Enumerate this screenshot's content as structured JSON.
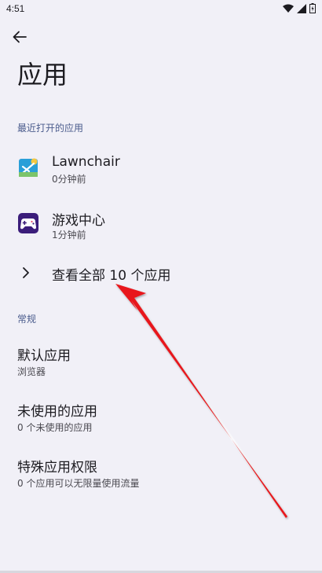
{
  "status_bar": {
    "time": "4:51",
    "icons": [
      "wifi-icon",
      "signal-icon",
      "battery-icon"
    ]
  },
  "header": {
    "title": "应用"
  },
  "recent_section": {
    "header": "最近打开的应用",
    "apps": [
      {
        "name": "Lawnchair",
        "time": "0分钟前",
        "icon": "lawnchair-icon"
      },
      {
        "name": "游戏中心",
        "time": "1分钟前",
        "icon": "game-center-icon"
      }
    ],
    "see_all_label": "查看全部 10 个应用"
  },
  "general_section": {
    "header": "常规",
    "items": [
      {
        "title": "默认应用",
        "subtitle": "浏览器"
      },
      {
        "title": "未使用的应用",
        "subtitle": "0 个未使用的应用"
      },
      {
        "title": "特殊应用权限",
        "subtitle": "0 个应用可以无限量使用流量"
      }
    ]
  },
  "colors": {
    "background": "#f1f0f7",
    "section_header": "#4a5b8c",
    "annotation_arrow": "#e8161b"
  }
}
